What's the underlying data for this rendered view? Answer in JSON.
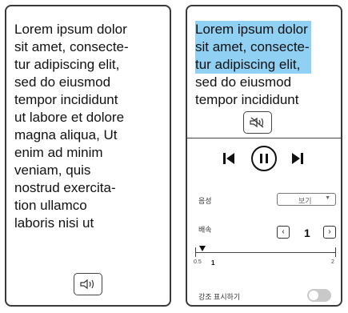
{
  "left_panel": {
    "lines": [
      "Lorem ipsum dolor",
      "sit amet, consecte-",
      "tur adipiscing elit,",
      "sed do eiusmod",
      "tempor incididunt",
      "ut labore et dolore",
      "magna aliqua, Ut",
      "enim ad minim",
      "veniam, quis",
      "nostrud exercita-",
      "tion ullamco",
      "laboris nisi ut"
    ],
    "tts_icon": "speaker-icon"
  },
  "right_panel": {
    "highlighted_lines": [
      "Lorem ipsum dolor",
      "sit amet, consecte-",
      "tur adipiscing elit,"
    ],
    "lines": [
      "sed do eiusmod",
      "tempor incididunt"
    ],
    "tts_icon": "speaker-mute-icon",
    "controls": {
      "voice_label": "음성",
      "voice_value": "보기",
      "speed_label": "배속",
      "speed_value": "1",
      "slider_min_label": "0.5",
      "slider_value_label": "1",
      "slider_max_label": "2",
      "slider_fraction": 0.05,
      "highlight_label": "강조 표시하기",
      "highlight_on": false
    }
  },
  "colors": {
    "highlight": "#8fd0f3",
    "toggle_off": "#c9c9c9"
  }
}
